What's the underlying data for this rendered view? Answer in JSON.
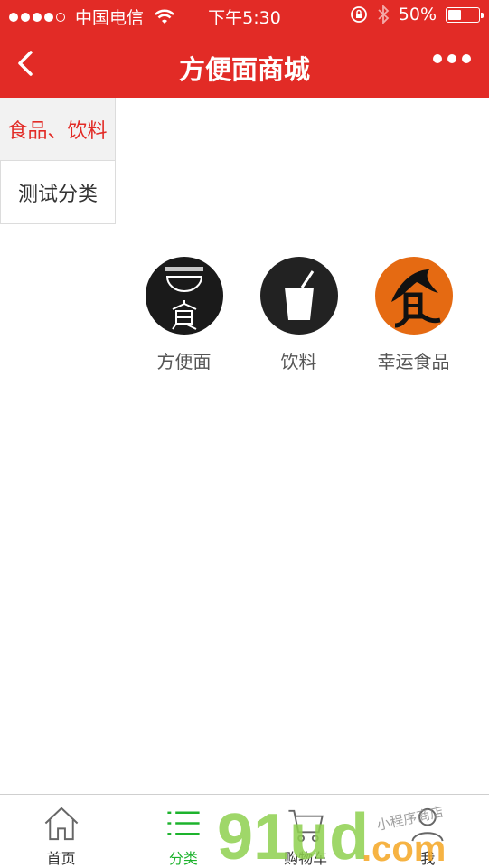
{
  "status_bar": {
    "carrier": "中国电信",
    "time": "下午5:30",
    "battery_percent": "50%",
    "battery_level": 0.5,
    "icons": [
      "signal-dots-icon",
      "wifi-icon",
      "rotation-lock-icon",
      "bluetooth-icon",
      "battery-icon"
    ]
  },
  "nav": {
    "title": "方便面商城",
    "back_icon": "chevron-left-icon",
    "more_icon": "more-dots-icon"
  },
  "side_menu": {
    "items": [
      {
        "label": "食品、饮料",
        "active": true
      },
      {
        "label": "测试分类",
        "active": false
      }
    ]
  },
  "grid": {
    "items": [
      {
        "label": "方便面",
        "icon": "noodle-bowl-icon"
      },
      {
        "label": "饮料",
        "icon": "drink-cup-icon"
      },
      {
        "label": "幸运食品",
        "icon": "food-character-icon"
      }
    ]
  },
  "tab_bar": {
    "items": [
      {
        "label": "首页",
        "icon": "home-icon",
        "active": false
      },
      {
        "label": "分类",
        "icon": "list-icon",
        "active": true
      },
      {
        "label": "购物车",
        "icon": "cart-icon",
        "active": false
      },
      {
        "label": "我",
        "icon": "user-icon",
        "active": false
      }
    ]
  },
  "watermark": {
    "text_main": "91ud",
    "text_dot": ".com",
    "text_small": "小程序商店"
  },
  "colors": {
    "brand_red": "#e22b26",
    "active_green": "#1db32d",
    "watermark_green": "#8fd14f",
    "watermark_orange": "#f5a623"
  }
}
